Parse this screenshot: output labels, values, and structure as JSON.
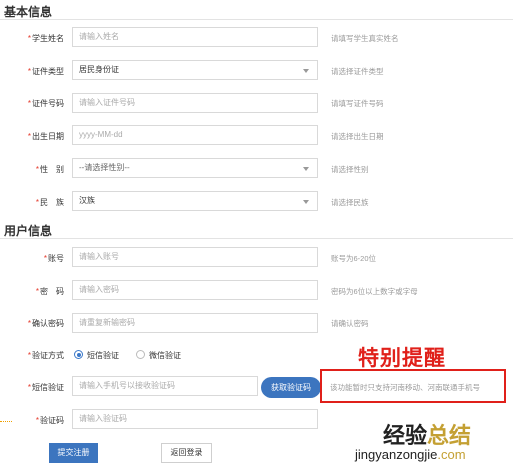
{
  "sections": {
    "basic": "基本信息",
    "user": "用户信息"
  },
  "basic_fields": {
    "name": {
      "label": "学生姓名",
      "placeholder": "请输入姓名",
      "hint": "请填写学生真实姓名"
    },
    "id_type": {
      "label": "证件类型",
      "value": "居民身份证",
      "hint": "请选择证件类型"
    },
    "id_number": {
      "label": "证件号码",
      "placeholder": "请输入证件号码",
      "hint": "请填写证件号码"
    },
    "birth": {
      "label": "出生日期",
      "placeholder": "yyyy-MM-dd",
      "hint": "请选择出生日期"
    },
    "gender": {
      "label": "性　别",
      "value": "--请选择性别--",
      "hint": "请选择性别"
    },
    "ethnic": {
      "label": "民　族",
      "value": "汉族",
      "hint": "请选择民族"
    }
  },
  "user_fields": {
    "account": {
      "label": "账号",
      "placeholder": "请输入账号",
      "hint": "账号为6-20位"
    },
    "password": {
      "label": "密　码",
      "placeholder": "请输入密码",
      "hint": "密码为6位以上数字或字母"
    },
    "confirm": {
      "label": "确认密码",
      "placeholder": "请重复新输密码",
      "hint": "请确认密码"
    },
    "verify_method": {
      "label": "验证方式",
      "options": [
        "短信验证",
        "微信验证"
      ],
      "selected": "短信验证"
    },
    "sms": {
      "label": "短信验证",
      "placeholder": "请输入手机号以接收验证码",
      "button": "获取验证码"
    },
    "code": {
      "label": "验证码",
      "placeholder": "请输入验证码"
    }
  },
  "notice": {
    "title": "特别提醒",
    "text": "该功能暂时只支持河南移动、河南联通手机号"
  },
  "actions": {
    "submit": "提交注册",
    "back": "返回登录"
  },
  "watermark": {
    "cn_main": "经验",
    "cn_accent": "总结",
    "url_main": "jingyanzongjie",
    "url_accent": ".com"
  },
  "colors": {
    "primary": "#3c75bf",
    "required": "#e5392a",
    "alert": "#e0201a"
  }
}
